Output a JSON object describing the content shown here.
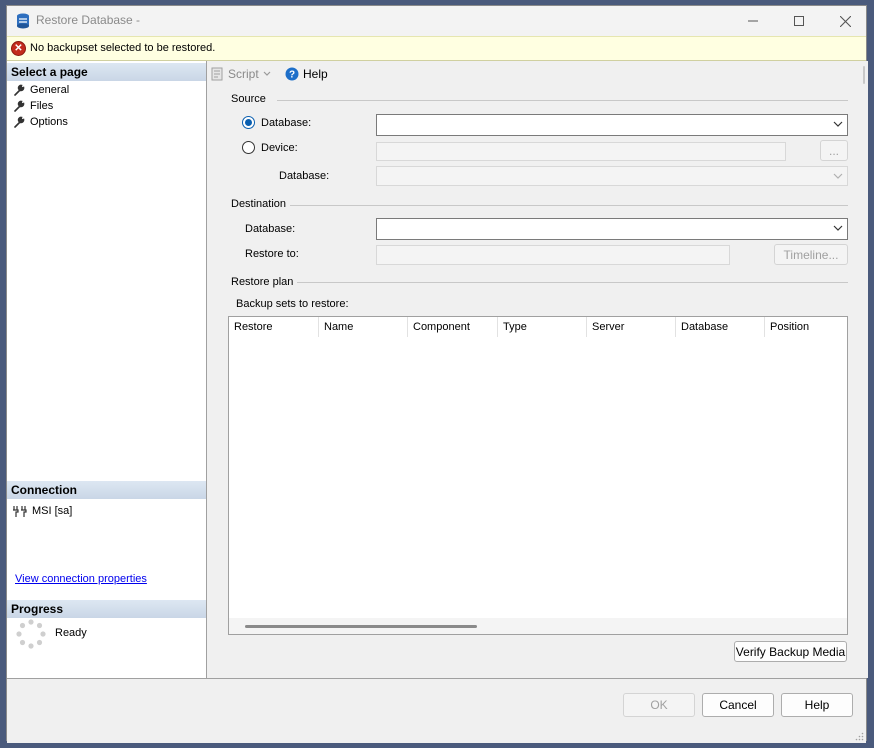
{
  "window": {
    "title": "Restore Database -"
  },
  "error": {
    "message": "No backupset selected to be restored."
  },
  "left": {
    "select_page_header": "Select a page",
    "pages": [
      {
        "label": "General"
      },
      {
        "label": "Files"
      },
      {
        "label": "Options"
      }
    ],
    "connection_header": "Connection",
    "connection_value": "MSI [sa]",
    "view_connection_link": "View connection properties",
    "progress_header": "Progress",
    "progress_status": "Ready"
  },
  "toolbar": {
    "script_label": "Script",
    "help_label": "Help"
  },
  "source": {
    "group_label": "Source",
    "database_radio_label": "Database:",
    "device_radio_label": "Device:",
    "database_label": "Database:",
    "database_value": "",
    "device_value": "",
    "device_database_value": "",
    "browse_label": "..."
  },
  "destination": {
    "group_label": "Destination",
    "database_label": "Database:",
    "database_value": "",
    "restore_to_label": "Restore to:",
    "restore_to_value": "",
    "timeline_label": "Timeline..."
  },
  "restore_plan": {
    "group_label": "Restore plan",
    "backup_sets_label": "Backup sets to restore:",
    "columns": [
      "Restore",
      "Name",
      "Component",
      "Type",
      "Server",
      "Database",
      "Position"
    ],
    "verify_label": "Verify Backup Media"
  },
  "buttons": {
    "ok": "OK",
    "cancel": "Cancel",
    "help": "Help"
  }
}
